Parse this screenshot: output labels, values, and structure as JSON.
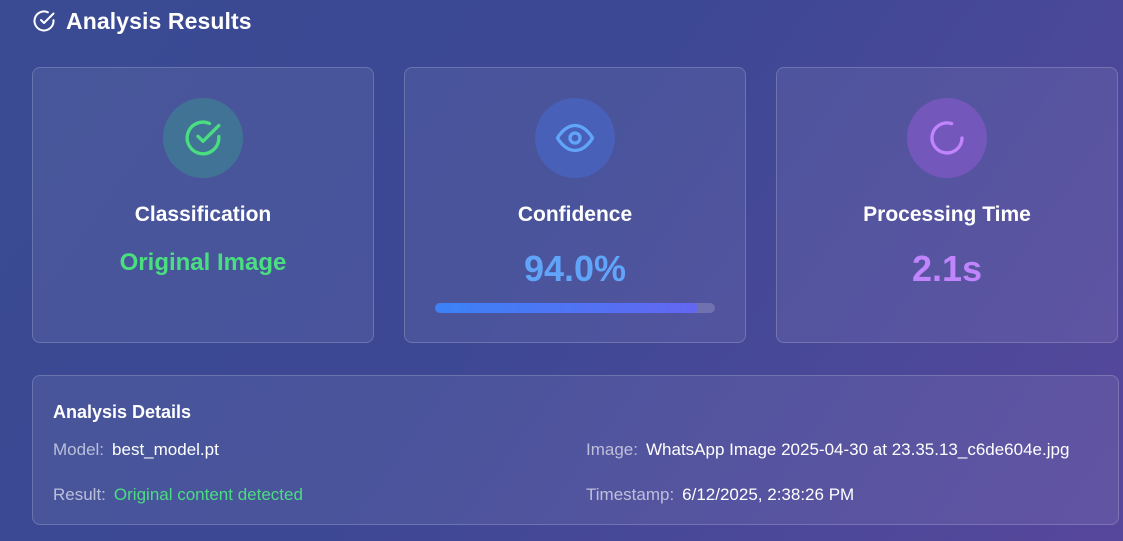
{
  "header": {
    "title": "Analysis Results",
    "icon": "check-circle-icon"
  },
  "cards": {
    "classification": {
      "title": "Classification",
      "value": "Original Image",
      "icon": "check-circle-icon",
      "color": "#4ade80"
    },
    "confidence": {
      "title": "Confidence",
      "value": "94.0%",
      "progress": 0.94,
      "icon": "eye-icon",
      "color": "#60a5fa"
    },
    "processing": {
      "title": "Processing Time",
      "value": "2.1s",
      "icon": "loading-spinner-icon",
      "color": "#c084fc"
    }
  },
  "details": {
    "title": "Analysis Details",
    "model_label": "Model:",
    "model_value": "best_model.pt",
    "image_label": "Image:",
    "image_value": "WhatsApp Image 2025-04-30 at 23.35.13_c6de604e.jpg",
    "result_label": "Result:",
    "result_value": "Original content detected",
    "timestamp_label": "Timestamp:",
    "timestamp_value": "6/12/2025, 2:38:26 PM"
  }
}
